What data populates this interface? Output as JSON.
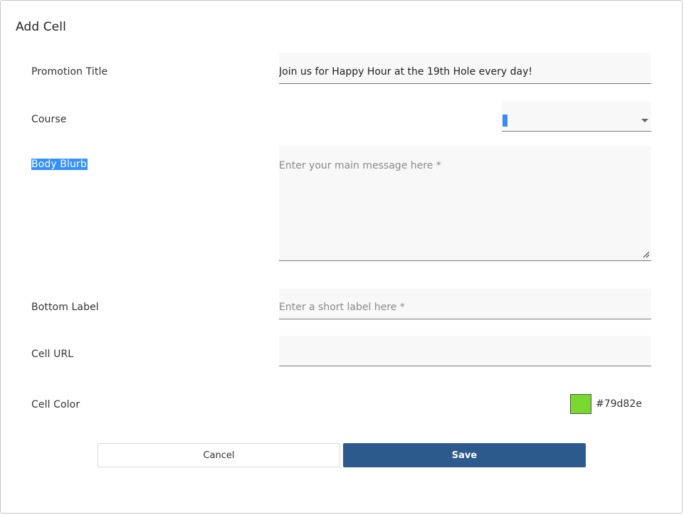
{
  "dialog": {
    "title": "Add Cell"
  },
  "form": {
    "promotion_title": {
      "label": "Promotion Title",
      "value": "Join us for Happy Hour at the 19th Hole every day!"
    },
    "course": {
      "label": "Course",
      "value": ""
    },
    "body_blurb": {
      "label": "Body Blurb",
      "placeholder": "Enter your main message here *",
      "value": ""
    },
    "bottom_label": {
      "label": "Bottom Label",
      "placeholder": "Enter a short label here *",
      "value": ""
    },
    "cell_url": {
      "label": "Cell URL",
      "value": ""
    },
    "cell_color": {
      "label": "Cell Color",
      "value": "#79d82e"
    }
  },
  "actions": {
    "cancel_label": "Cancel",
    "save_label": "Save"
  },
  "colors": {
    "save_button": "#2c5a8c",
    "text_selection": "#3390ff",
    "swatch": "#79d82e"
  },
  "icons": {
    "course_dropdown": "chevron-down-icon",
    "textarea_resize": "resize-grip-icon"
  }
}
